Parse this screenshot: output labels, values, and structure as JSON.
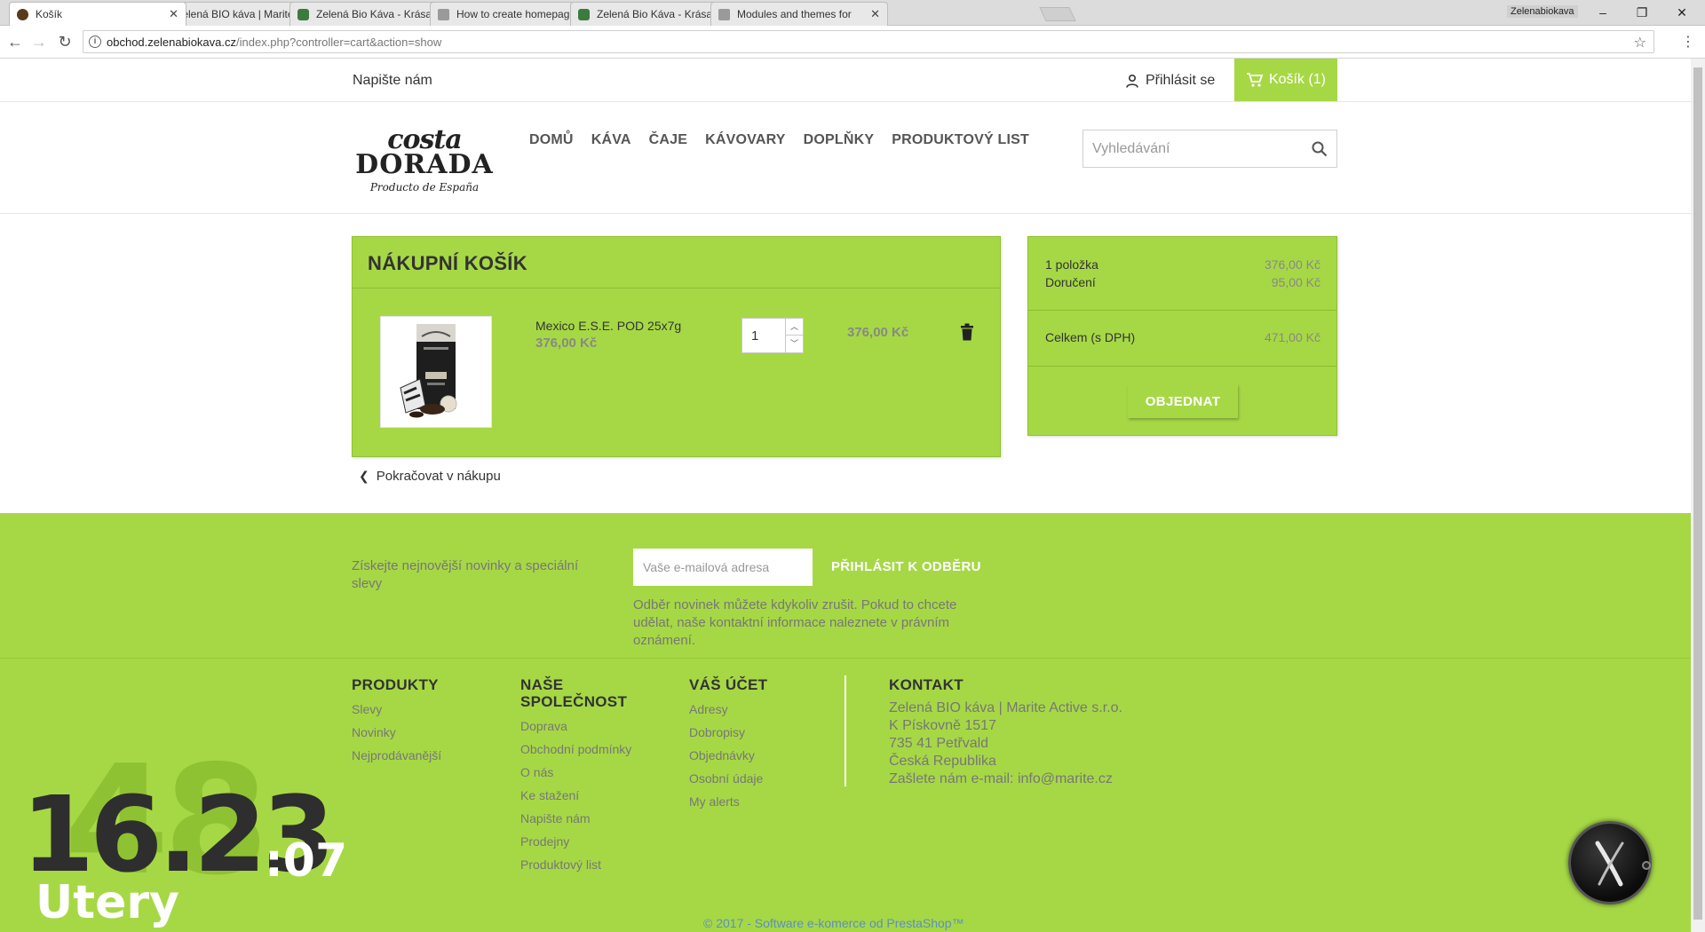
{
  "browser": {
    "tabs": [
      {
        "title": "Košík",
        "favicon": "coffee-bean-icon",
        "active": true
      },
      {
        "title": "Zelená BIO káva | Marite",
        "favicon": "coffee-bean-icon",
        "active": false
      },
      {
        "title": "Zelená Bio Káva - Krása",
        "favicon": "shield-icon",
        "active": false
      },
      {
        "title": "How to create homepage",
        "favicon": "wrench-icon",
        "active": false
      },
      {
        "title": "Zelená Bio Káva - Krása",
        "favicon": "shield-icon",
        "active": false
      },
      {
        "title": "Modules and themes for",
        "favicon": "wrench-icon",
        "active": false
      }
    ],
    "profile_name": "Zelenabiokava",
    "url_host": "obchod.zelenabiokava.cz",
    "url_path": "/index.php?controller=cart&action=show"
  },
  "topnav": {
    "contact_label": "Napište nám",
    "login_label": "Přihlásit se",
    "cart_label": "Košík (1)"
  },
  "logo": {
    "line1": "costa",
    "line2": "DORADA",
    "line3": "Producto de España"
  },
  "menu": [
    "DOMŮ",
    "KÁVA",
    "ČAJE",
    "KÁVOVARY",
    "DOPLŇKY",
    "PRODUKTOVÝ LIST"
  ],
  "search": {
    "placeholder": "Vyhledávání"
  },
  "cart": {
    "title": "NÁKUPNÍ KOŠÍK",
    "item": {
      "name": "Mexico E.S.E. POD 25x7g",
      "unit_price": "376,00 Kč",
      "quantity": "1",
      "line_total": "376,00 Kč"
    },
    "continue_label": "Pokračovat v nákupu"
  },
  "summary": {
    "items_label": "1 položka",
    "items_value": "376,00 Kč",
    "shipping_label": "Doručení",
    "shipping_value": "95,00 Kč",
    "total_label": "Celkem (s DPH)",
    "total_value": "471,00 Kč",
    "order_button": "OBJEDNAT"
  },
  "newsletter": {
    "text": "Získejte nejnovější novinky a speciální slevy",
    "placeholder": "Vaše e-mailová adresa",
    "button": "PŘIHLÁSIT K ODBĚRU",
    "note": "Odběr novinek můžete kdykoliv zrušit. Pokud to chcete udělat, naše kontaktní informace naleznete v právním oznámení."
  },
  "footer": {
    "col1": {
      "heading": "PRODUKTY",
      "links": [
        "Slevy",
        "Novinky",
        "Nejprodávanější"
      ]
    },
    "col2": {
      "heading_line1": "NAŠE",
      "heading_line2": "SPOLEČNOST",
      "links": [
        "Doprava",
        "Obchodní podmínky",
        "O nás",
        "Ke stažení",
        "Napište nám",
        "Prodejny",
        "Produktový list"
      ]
    },
    "col3": {
      "heading": "VÁŠ ÚČET",
      "links": [
        "Adresy",
        "Dobropisy",
        "Objednávky",
        "Osobní údaje",
        "My alerts"
      ]
    },
    "contact": {
      "heading": "KONTAKT",
      "lines": [
        "Zelená BIO káva | Marite Active s.r.o.",
        "K Pískovně 1517",
        "735 41 Petřvald",
        "Česká Republika",
        "Zašlete nám e-mail: info@marite.cz"
      ]
    },
    "copyright": "© 2017 - Software e-komerce od PrestaShop™"
  },
  "desktop_clock": {
    "week": "48",
    "time": "16.23",
    "seconds": ":07",
    "day": "Utery"
  },
  "colors": {
    "accent_green": "#a6d845",
    "muted_text": "#777777",
    "link_blue": "#5a8fc0"
  }
}
